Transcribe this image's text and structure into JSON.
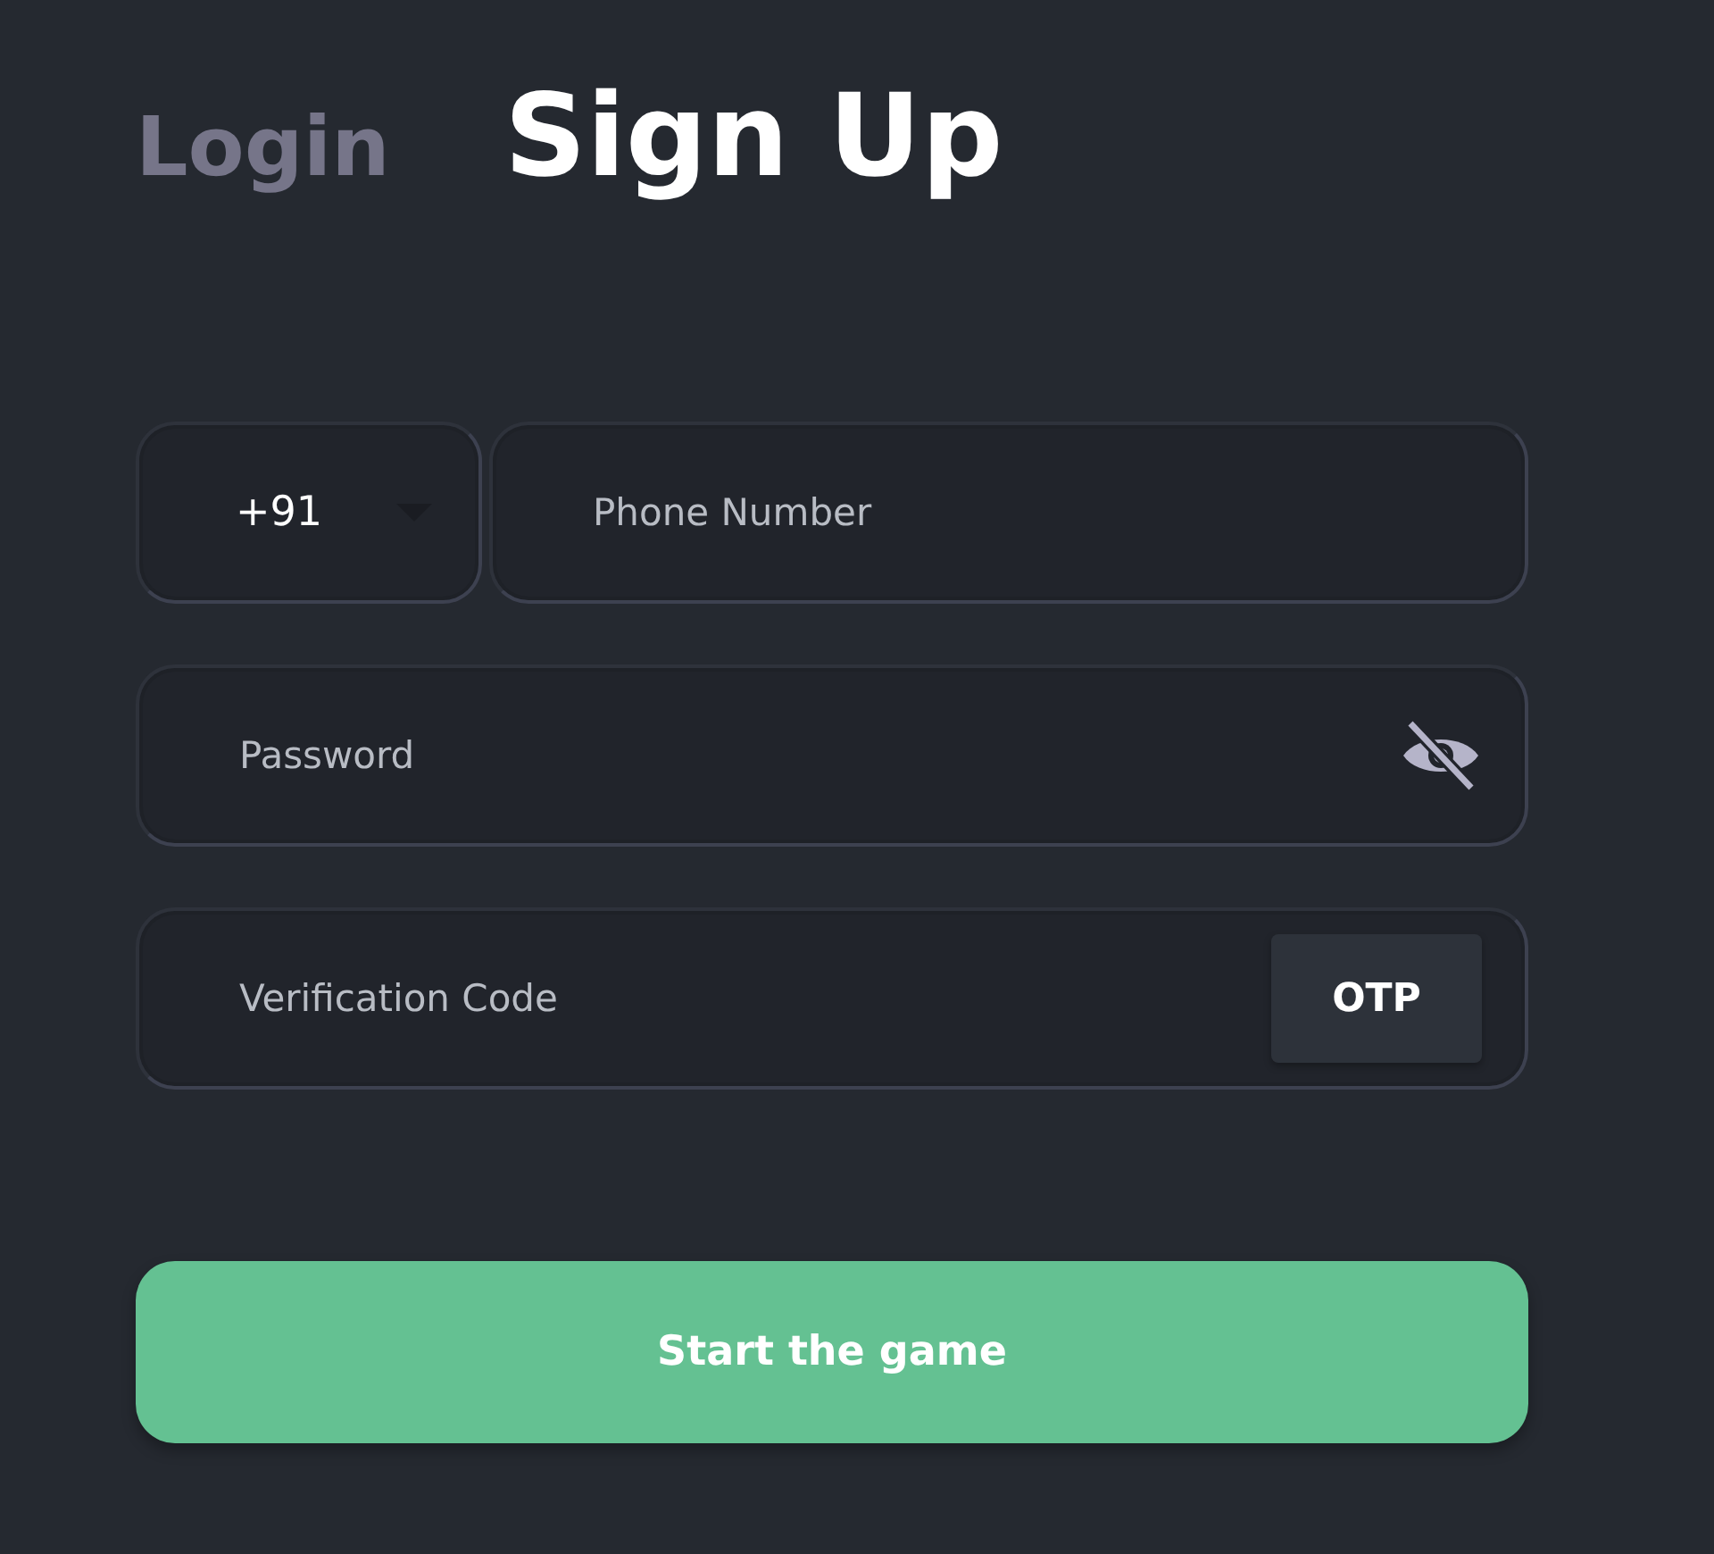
{
  "tabs": [
    {
      "label": "Login",
      "selected": false
    },
    {
      "label": "Sign Up",
      "selected": true
    }
  ],
  "country_code": {
    "value": "+91"
  },
  "phone": {
    "placeholder": "Phone Number"
  },
  "password": {
    "placeholder": "Password",
    "visible": false
  },
  "verification": {
    "placeholder": "Verification Code",
    "button": "OTP"
  },
  "submit": "Start the game"
}
